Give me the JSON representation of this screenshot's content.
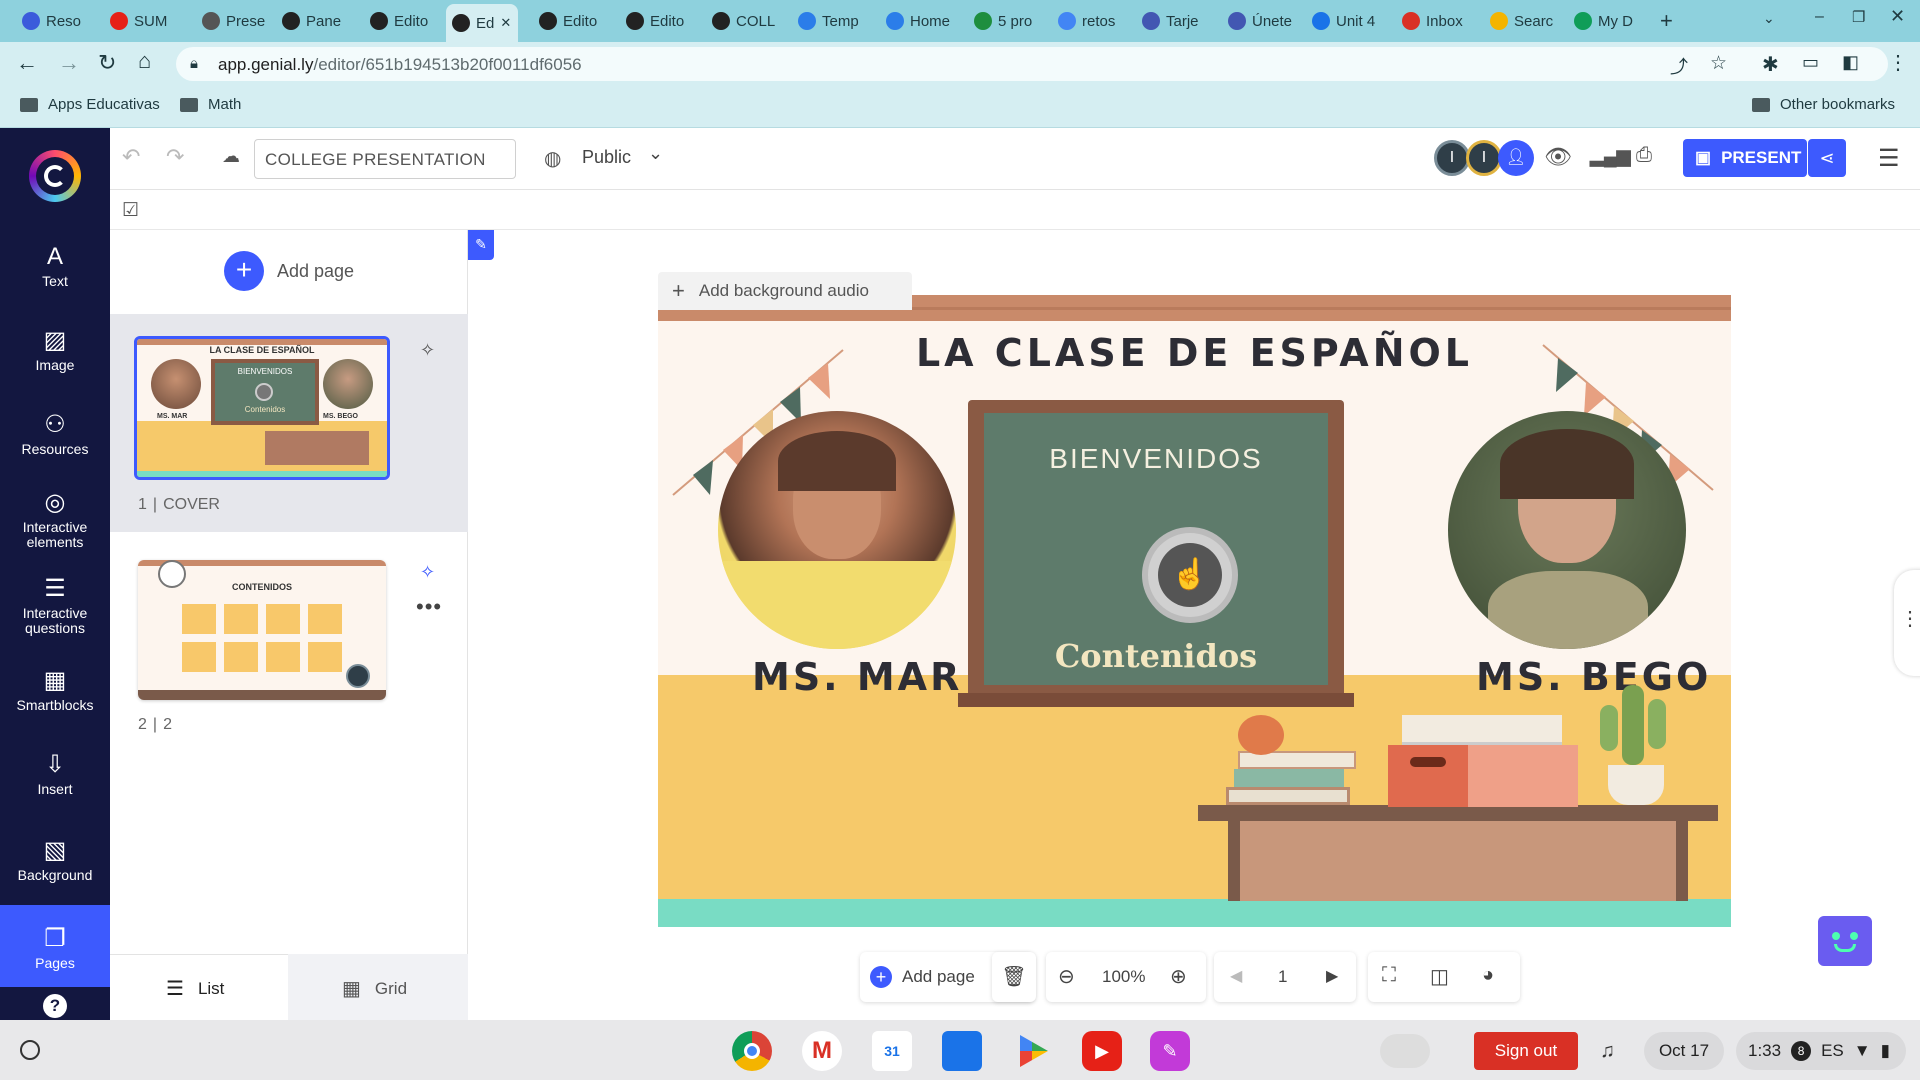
{
  "browser": {
    "tabs": [
      {
        "label": "Reso",
        "icon": "canvas-icon",
        "color": "#3b5bdb"
      },
      {
        "label": "SUM",
        "icon": "youtube-icon",
        "color": "#e62117"
      },
      {
        "label": "Prese",
        "icon": "globe-icon",
        "color": "#555555"
      },
      {
        "label": "Pane",
        "icon": "genially-icon",
        "color": "#222222"
      },
      {
        "label": "Edito",
        "icon": "genially-icon",
        "color": "#222222"
      },
      {
        "label": "Ed",
        "icon": "genially-icon",
        "color": "#222222"
      },
      {
        "label": "Edito",
        "icon": "genially-icon",
        "color": "#222222"
      },
      {
        "label": "Edito",
        "icon": "genially-icon",
        "color": "#222222"
      },
      {
        "label": "COLL",
        "icon": "genially-icon",
        "color": "#222222"
      },
      {
        "label": "Temp",
        "icon": "canva-icon",
        "color": "#2b7de9"
      },
      {
        "label": "Home",
        "icon": "canva-icon",
        "color": "#2b7de9"
      },
      {
        "label": "5 pro",
        "icon": "sheets-icon",
        "color": "#1e8e3e"
      },
      {
        "label": "retos",
        "icon": "google-icon",
        "color": "#4285f4"
      },
      {
        "label": "Tarje",
        "icon": "quizlet-icon",
        "color": "#4257b2"
      },
      {
        "label": "Únete",
        "icon": "quizlet-icon",
        "color": "#4257b2"
      },
      {
        "label": "Unit 4",
        "icon": "docs-icon",
        "color": "#1a73e8"
      },
      {
        "label": "Inbox",
        "icon": "gmail-icon",
        "color": "#d93025"
      },
      {
        "label": "Searc",
        "icon": "drive-icon",
        "color": "#f4b400"
      },
      {
        "label": "My D",
        "icon": "drive-icon",
        "color": "#0f9d58"
      }
    ],
    "url_host": "app.genial.ly",
    "url_path": "/editor/651b194513b20f0011df6056",
    "bookmarks": [
      "Apps Educativas",
      "Math"
    ],
    "other_bookmarks": "Other bookmarks"
  },
  "sidebar": {
    "items": [
      {
        "label": "Text",
        "icon": "text-icon"
      },
      {
        "label": "Image",
        "icon": "image-icon"
      },
      {
        "label": "Resources",
        "icon": "resources-icon"
      },
      {
        "label": "Interactive elements",
        "icon": "interactive-elements-icon"
      },
      {
        "label": "Interactive questions",
        "icon": "interactive-questions-icon"
      },
      {
        "label": "Smartblocks",
        "icon": "smartblocks-icon"
      },
      {
        "label": "Insert",
        "icon": "insert-icon"
      },
      {
        "label": "Background",
        "icon": "background-icon"
      },
      {
        "label": "Pages",
        "icon": "pages-icon"
      }
    ],
    "help": "?"
  },
  "editor": {
    "title": "COLLEGE PRESENTATION",
    "visibility": "Public",
    "avatar_initials": [
      "I",
      "I"
    ],
    "present_label": "PRESENT",
    "accent": "#3d5afe"
  },
  "pages_panel": {
    "add_page": "Add page",
    "pages": [
      {
        "number": "1",
        "name": "COVER",
        "thumb_title": "LA CLASE DE ESPAÑOL",
        "thumb_left": "MS. MAR",
        "thumb_right": "MS. BEGO",
        "thumb_board": "BIENVENIDOS",
        "thumb_link": "Contenidos"
      },
      {
        "number": "2",
        "name": "2",
        "thumb_title": "CONTENIDOS"
      }
    ],
    "view_list": "List",
    "view_grid": "Grid"
  },
  "slide": {
    "add_audio": "Add background audio",
    "title": "LA CLASE DE ESPAÑOL",
    "board_heading": "BIENVENIDOS",
    "board_link": "Contenidos",
    "left_name": "MS. MAR",
    "right_name": "MS. BEGO"
  },
  "bottom_toolbar": {
    "add_page": "Add page",
    "zoom": "100%",
    "page": "1"
  },
  "taskbar": {
    "sign_out": "Sign out",
    "date": "Oct 17",
    "time": "1:33",
    "badge": "8",
    "lang": "ES"
  }
}
